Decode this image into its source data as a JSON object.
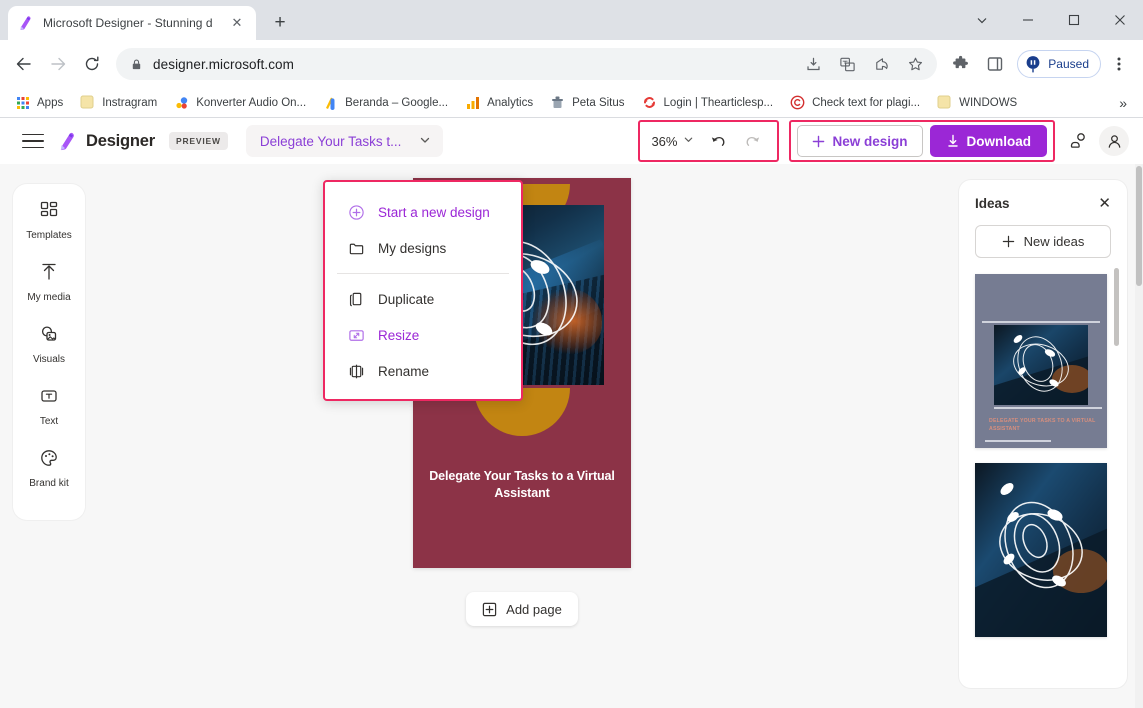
{
  "browser": {
    "tab": {
      "title": "Microsoft Designer - Stunning d",
      "favicon": "designer-favicon",
      "close": "✕"
    },
    "newtab_label": "+",
    "window_controls": {
      "chevron": "chevron-down-icon",
      "minimize": "minimize-icon",
      "maximize": "maximize-icon",
      "close": "close-icon"
    },
    "nav": {
      "back": "back-arrow-icon",
      "forward": "forward-arrow-icon",
      "reload": "reload-icon"
    },
    "omnibox": {
      "lock": "lock-icon",
      "url": "designer.microsoft.com"
    },
    "omnibox_actions": [
      "install-icon",
      "translate-icon",
      "share-icon",
      "bookmark-star-icon"
    ],
    "toolbar_actions": [
      "extensions-puzzle-icon",
      "side-panel-icon"
    ],
    "profile": {
      "label": "Paused",
      "icon": "profile-paused-icon"
    },
    "menu_icon": "kebab-menu-icon",
    "bookmarks": [
      {
        "label": "Apps",
        "icon": "apps-grid-icon"
      },
      {
        "label": "Instragram",
        "icon": "instagram-icon"
      },
      {
        "label": "Konverter Audio On...",
        "icon": "konverter-icon"
      },
      {
        "label": "Beranda – Google...",
        "icon": "google-icon"
      },
      {
        "label": "Analytics",
        "icon": "analytics-icon"
      },
      {
        "label": "Peta Situs",
        "icon": "sitemap-icon"
      },
      {
        "label": "Login | Thearticlesp...",
        "icon": "refresh-red-icon"
      },
      {
        "label": "Check text for plagi...",
        "icon": "copyright-icon"
      },
      {
        "label": "WINDOWS",
        "icon": "folder-yellow-icon"
      }
    ],
    "bookmarks_overflow": "»"
  },
  "app": {
    "hamburger": "hamburger-menu-icon",
    "brand": {
      "name": "Designer",
      "logo": "designer-logo-icon",
      "preview_badge": "PREVIEW"
    },
    "document": {
      "name": "Delegate Your Tasks t...",
      "chevron": "chevron-down-icon"
    },
    "zoom": {
      "value": "36%",
      "chevron": "chevron-down-icon",
      "undo": "undo-icon",
      "redo": "redo-icon"
    },
    "actions": {
      "new_design": {
        "label": "New design",
        "icon": "plus-icon"
      },
      "download": {
        "label": "Download",
        "icon": "download-arrow-icon"
      },
      "collaborate": "collaborate-icon",
      "account": "account-avatar-icon"
    },
    "highlight_color": "#ee2862",
    "accent_color": "#9b27d6"
  },
  "rail": {
    "items": [
      {
        "label": "Templates",
        "icon": "templates-grid-icon"
      },
      {
        "label": "My media",
        "icon": "upload-arrow-icon"
      },
      {
        "label": "Visuals",
        "icon": "visuals-image-icon"
      },
      {
        "label": "Text",
        "icon": "text-box-icon"
      },
      {
        "label": "Brand kit",
        "icon": "palette-icon"
      }
    ]
  },
  "menu": {
    "groups": [
      [
        {
          "label": "Start a new design",
          "icon": "plus-circle-icon",
          "accent": true
        },
        {
          "label": "My designs",
          "icon": "folder-icon",
          "accent": false
        }
      ],
      [
        {
          "label": "Duplicate",
          "icon": "duplicate-icon",
          "accent": false
        },
        {
          "label": "Resize",
          "icon": "resize-icon",
          "accent": true
        },
        {
          "label": "Rename",
          "icon": "rename-icon",
          "accent": false
        }
      ]
    ]
  },
  "canvas": {
    "page": {
      "title": "Delegate Your Tasks to a Virtual Assistant",
      "background_color": "#8c3347",
      "accent_shape_color": "#c28512",
      "photo": "hands-on-keyboard-photo"
    },
    "add_page": {
      "label": "Add page",
      "icon": "add-page-icon"
    }
  },
  "ideas": {
    "title": "Ideas",
    "close": "✕",
    "new_ideas": {
      "label": "New ideas",
      "icon": "plus-icon"
    },
    "thumbnails": [
      {
        "name": "idea-thumbnail-1",
        "text": "DELEGATE YOUR TASKS TO A VIRTUAL ASSISTANT",
        "background_color": "#767c92"
      },
      {
        "name": "idea-thumbnail-2",
        "text": "",
        "background_color": "#0e2334"
      }
    ]
  }
}
